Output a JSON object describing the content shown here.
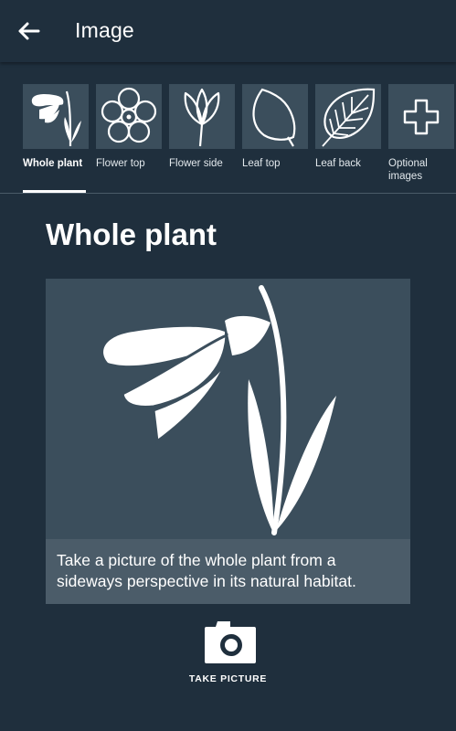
{
  "appbar": {
    "title": "Image",
    "back_icon": "arrow-back-icon"
  },
  "tabs": [
    {
      "label": "Whole plant",
      "icon": "whole-plant-icon",
      "active": true
    },
    {
      "label": "Flower top",
      "icon": "flower-top-icon"
    },
    {
      "label": "Flower side",
      "icon": "flower-side-icon"
    },
    {
      "label": "Leaf top",
      "icon": "leaf-top-icon"
    },
    {
      "label": "Leaf back",
      "icon": "leaf-back-icon"
    },
    {
      "label": "Optional images",
      "icon": "plus-icon"
    }
  ],
  "main": {
    "title": "Whole plant",
    "caption": "Take a picture of the whole plant from a sideways perspective in its natural habitat.",
    "illustration_icon": "whole-plant-illustration",
    "take_picture_label": "TAKE PICTURE",
    "camera_icon": "camera-icon"
  },
  "colors": {
    "background": "#1f2f3d",
    "tile": "#3b4e5c",
    "caption_bg": "#4b5c69",
    "accent": "#ffffff"
  }
}
